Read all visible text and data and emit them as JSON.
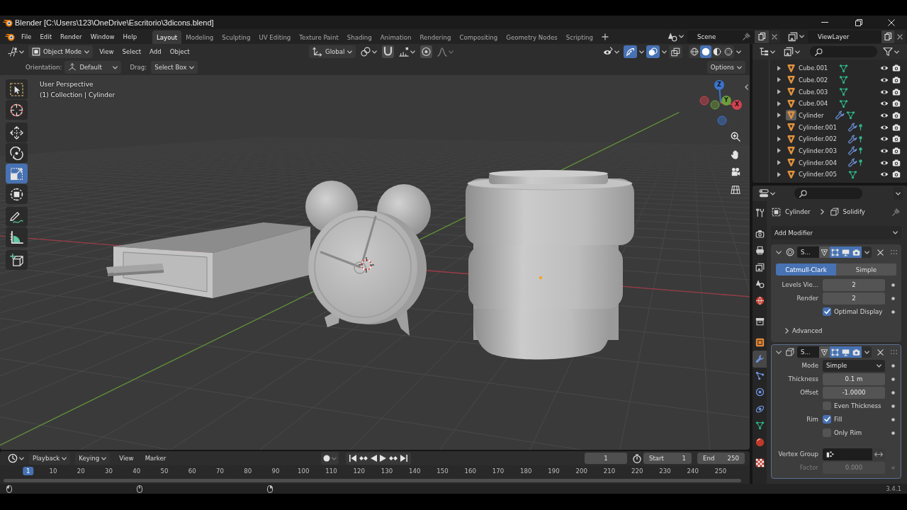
{
  "title_bar": {
    "title": "Blender [C:\\Users\\123\\OneDrive\\Escritorio\\3dicons.blend]"
  },
  "top_bar": {
    "menus": [
      "File",
      "Edit",
      "Render",
      "Window",
      "Help"
    ],
    "workspaces": [
      {
        "label": "Layout",
        "selected": true
      },
      {
        "label": "Modeling",
        "selected": false
      },
      {
        "label": "Sculpting",
        "selected": false
      },
      {
        "label": "UV Editing",
        "selected": false
      },
      {
        "label": "Texture Paint",
        "selected": false
      },
      {
        "label": "Shading",
        "selected": false
      },
      {
        "label": "Animation",
        "selected": false
      },
      {
        "label": "Rendering",
        "selected": false
      },
      {
        "label": "Compositing",
        "selected": false
      },
      {
        "label": "Geometry Nodes",
        "selected": false
      },
      {
        "label": "Scripting",
        "selected": false
      }
    ],
    "scene": "Scene",
    "view_layer": "ViewLayer"
  },
  "viewport": {
    "header": {
      "mode": "Object Mode",
      "menus": [
        "View",
        "Select",
        "Add",
        "Object"
      ],
      "orientation": "Global",
      "gizmos": true,
      "overlays": true,
      "xray": false,
      "shading": [
        {
          "kind": "wireframe",
          "selected": false
        },
        {
          "kind": "solid",
          "selected": true
        },
        {
          "kind": "material",
          "selected": false
        },
        {
          "kind": "rendered",
          "selected": false
        }
      ]
    },
    "tool_settings": {
      "orientation_label": "Orientation:",
      "orientation": "Default",
      "drag_label": "Drag:",
      "drag": "Select Box",
      "options": "Options"
    },
    "info": [
      "User Perspective",
      "(1) Collection | Cylinder"
    ],
    "tool_groups": [
      [
        {
          "kind": "select_box",
          "selected": false
        },
        {
          "kind": "cursor",
          "selected": false
        }
      ],
      [
        {
          "kind": "move",
          "selected": false
        },
        {
          "kind": "rotate",
          "selected": false
        },
        {
          "kind": "scale",
          "selected": true
        },
        {
          "kind": "transform",
          "selected": false
        }
      ],
      [
        {
          "kind": "annotate",
          "selected": false
        },
        {
          "kind": "measure",
          "selected": false
        }
      ],
      [
        {
          "kind": "add_cube",
          "selected": false
        }
      ]
    ],
    "gizmo_axes": [
      {
        "label": "Z",
        "color": "#3b74cf"
      },
      {
        "label": "Y",
        "color": "#6c9e3c"
      },
      {
        "label": "X",
        "color": "#d2424f"
      }
    ]
  },
  "outliner": {
    "rows": [
      {
        "name": "Cube.001",
        "kind": "mesh",
        "selected": false
      },
      {
        "name": "Cube.002",
        "kind": "mesh",
        "selected": false
      },
      {
        "name": "Cube.003",
        "kind": "mesh",
        "selected": false
      },
      {
        "name": "Cube.004",
        "kind": "mesh",
        "selected": false
      },
      {
        "name": "Cylinder",
        "kind": "mesh_modified",
        "selected": true
      },
      {
        "name": "Cylinder.001",
        "kind": "modified_pinned",
        "selected": false
      },
      {
        "name": "Cylinder.002",
        "kind": "modified_pinned",
        "selected": false
      },
      {
        "name": "Cylinder.003",
        "kind": "modified_pinned",
        "selected": false
      },
      {
        "name": "Cylinder.004",
        "kind": "modified_pinned",
        "selected": false
      },
      {
        "name": "Cylinder.005",
        "kind": "mesh",
        "selected": false
      }
    ]
  },
  "properties": {
    "tab_groups": [
      [
        {
          "kind": "tool",
          "selected": false
        }
      ],
      [
        {
          "kind": "render",
          "selected": false
        },
        {
          "kind": "output",
          "selected": false
        },
        {
          "kind": "view_layer",
          "selected": false
        },
        {
          "kind": "scene",
          "selected": false
        },
        {
          "kind": "world",
          "selected": false
        }
      ],
      [
        {
          "kind": "collection",
          "selected": false
        }
      ],
      [
        {
          "kind": "object",
          "selected": false
        },
        {
          "kind": "modifiers",
          "selected": true
        },
        {
          "kind": "particles",
          "selected": false
        },
        {
          "kind": "physics",
          "selected": false
        },
        {
          "kind": "constraints",
          "selected": false
        },
        {
          "kind": "data",
          "selected": false
        },
        {
          "kind": "material",
          "selected": false
        }
      ],
      [
        {
          "kind": "texture",
          "selected": false
        }
      ]
    ],
    "object": "Cylinder",
    "modifier": "Solidify",
    "add_modifier": "Add Modifier",
    "modifiers": [
      {
        "kind": "subdivision",
        "name": "S...",
        "expanded": true,
        "active": false,
        "on_cage": false,
        "edit_mode": true,
        "viewport": true,
        "render": true,
        "rows": [
          {
            "kind": "segmented",
            "disabled": false,
            "options": [
              {
                "label": "Catmull-Clark",
                "selected": true
              },
              {
                "label": "Simple",
                "selected": false
              }
            ]
          },
          {
            "kind": "number",
            "label": "Levels Vie...",
            "value": "2",
            "disabled": false
          },
          {
            "kind": "number",
            "label": "Render",
            "value": "2",
            "disabled": false
          },
          {
            "kind": "checkbox",
            "text": "Optimal Display",
            "checked": true,
            "disabled": false
          },
          {
            "kind": "subpanel",
            "text": "Advanced",
            "expanded": false,
            "disabled": false
          }
        ]
      },
      {
        "kind": "solidify",
        "name": "S...",
        "expanded": true,
        "active": true,
        "on_cage": false,
        "edit_mode": true,
        "viewport": true,
        "render": true,
        "rows": [
          {
            "kind": "dropdown",
            "label": "Mode",
            "value": "Simple",
            "disabled": false
          },
          {
            "kind": "number",
            "label": "Thickness",
            "value": "0.1 m",
            "disabled": false
          },
          {
            "kind": "number",
            "label": "Offset",
            "value": "-1.0000",
            "disabled": false
          },
          {
            "kind": "checkbox",
            "text": "Even Thickness",
            "checked": false,
            "disabled": false
          },
          {
            "kind": "checkbox",
            "label": "Rim",
            "text": "Fill",
            "checked": true,
            "disabled": false
          },
          {
            "kind": "checkbox",
            "text": "Only Rim",
            "checked": false,
            "disabled": false
          },
          {
            "kind": "vertex_group",
            "label": "Vertex Group",
            "disabled": false
          },
          {
            "kind": "number",
            "label": "Factor",
            "value": "0.000",
            "disabled": true
          }
        ]
      }
    ]
  },
  "timeline": {
    "menus": [
      {
        "label": "Playback",
        "kind": "popover"
      },
      {
        "label": "Keying",
        "kind": "popover"
      },
      {
        "label": "View",
        "kind": "menu"
      },
      {
        "label": "Marker",
        "kind": "menu"
      }
    ],
    "current_frame": "1",
    "start_label": "Start",
    "start": "1",
    "end_label": "End",
    "end": "250",
    "playhead": "1",
    "ticks": [
      "10",
      "20",
      "30",
      "40",
      "50",
      "60",
      "70",
      "80",
      "90",
      "100",
      "110",
      "120",
      "130",
      "140",
      "150",
      "160",
      "170",
      "180",
      "190",
      "200",
      "210",
      "220",
      "230",
      "240",
      "250"
    ]
  },
  "status_bar": {
    "version": "3.4.1"
  }
}
